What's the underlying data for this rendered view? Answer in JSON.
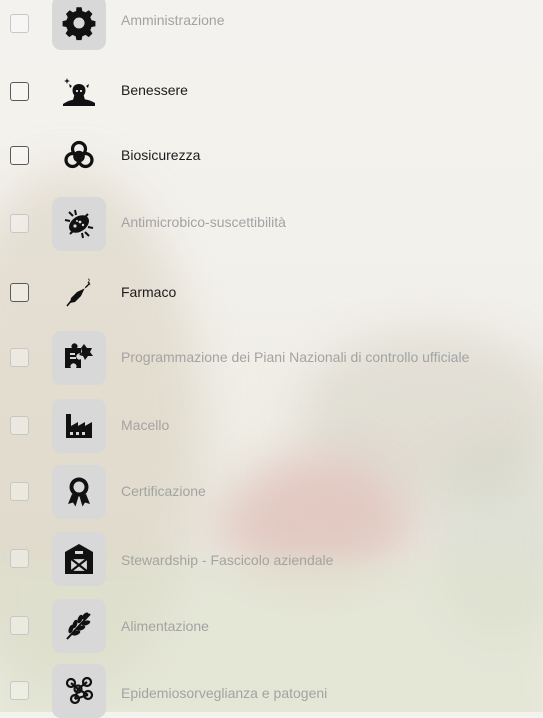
{
  "colors": {
    "active_text": "#1c1c1c",
    "inactive_text": "#a3a3a3",
    "tile_bg": "#d8d8d8",
    "icon": "#111111"
  },
  "categories": [
    {
      "label": "Amministrazione",
      "icon": "gear-icon",
      "active": false,
      "checked": false
    },
    {
      "label": "Benessere",
      "icon": "animal-welfare-icon",
      "active": true,
      "checked": false
    },
    {
      "label": "Biosicurezza",
      "icon": "biohazard-icon",
      "active": true,
      "checked": false
    },
    {
      "label": "Antimicrobico-suscettibilità",
      "icon": "bacterium-icon",
      "active": false,
      "checked": false
    },
    {
      "label": "Farmaco",
      "icon": "syringe-icon",
      "active": true,
      "checked": false
    },
    {
      "label": "Programmazione dei Piani Nazionali di controllo ufficiale",
      "icon": "puzzle-plan-icon",
      "active": false,
      "checked": false
    },
    {
      "label": "Macello",
      "icon": "factory-icon",
      "active": false,
      "checked": false
    },
    {
      "label": "Certificazione",
      "icon": "award-ribbon-icon",
      "active": false,
      "checked": false
    },
    {
      "label": "Stewardship - Fascicolo aziendale",
      "icon": "barn-icon",
      "active": false,
      "checked": false
    },
    {
      "label": "Alimentazione",
      "icon": "wheat-icon",
      "active": false,
      "checked": false
    },
    {
      "label": "Epidemiosorveglianza e patogeni",
      "icon": "molecule-network-icon",
      "active": false,
      "checked": false
    }
  ]
}
